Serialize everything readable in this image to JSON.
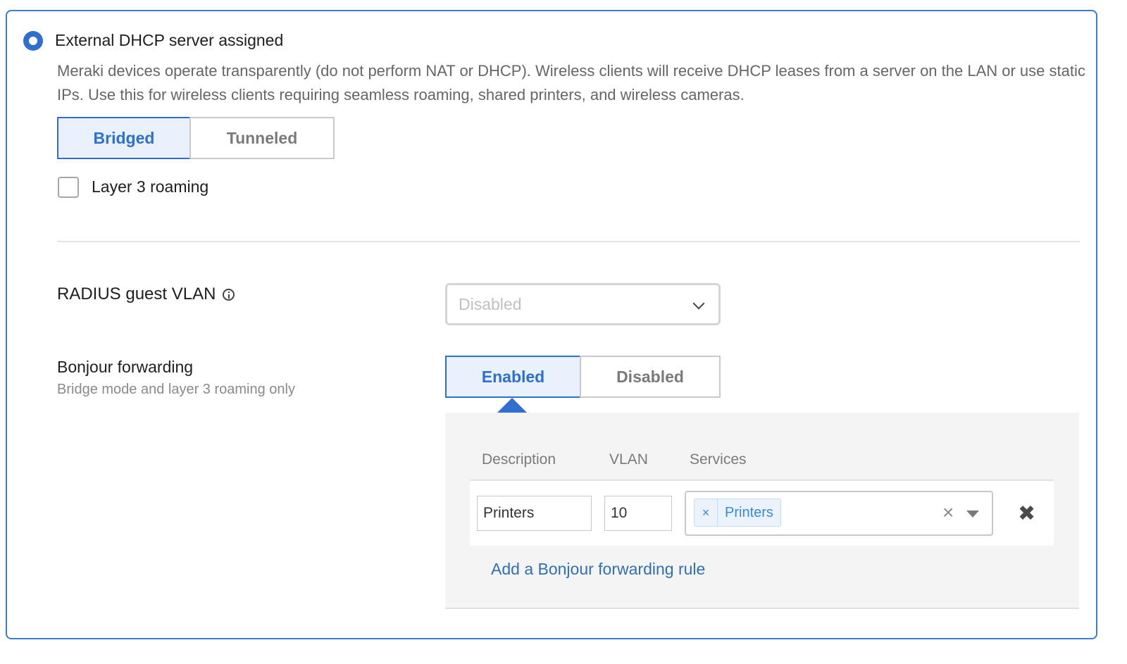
{
  "mode": {
    "title": "External DHCP server assigned",
    "description": "Meraki devices operate transparently (do not perform NAT or DHCP). Wireless clients will receive DHCP leases from a server on the LAN or use static IPs. Use this for wireless clients requiring seamless roaming, shared printers, and wireless cameras.",
    "selected": true
  },
  "tunnel_toggle": {
    "options": [
      "Bridged",
      "Tunneled"
    ],
    "selected": "Bridged"
  },
  "layer3_roaming": {
    "label": "Layer 3 roaming",
    "checked": false
  },
  "radius_guest_vlan": {
    "label": "RADIUS guest VLAN",
    "icon": "info-icon",
    "placeholder": "Disabled"
  },
  "bonjour": {
    "label": "Bonjour forwarding",
    "sublabel": "Bridge mode and layer 3 roaming only",
    "options": [
      "Enabled",
      "Disabled"
    ],
    "selected": "Enabled",
    "table": {
      "headers": [
        "Description",
        "VLAN",
        "Services"
      ],
      "rows": [
        {
          "description": "Printers",
          "vlan": "10",
          "services": [
            "Printers"
          ]
        }
      ]
    },
    "add_rule_label": "Add a Bonjour forwarding rule"
  },
  "colors": {
    "accent": "#2f6fd1",
    "link": "#2f6fb5",
    "panel_bg": "#f4f4f4"
  }
}
